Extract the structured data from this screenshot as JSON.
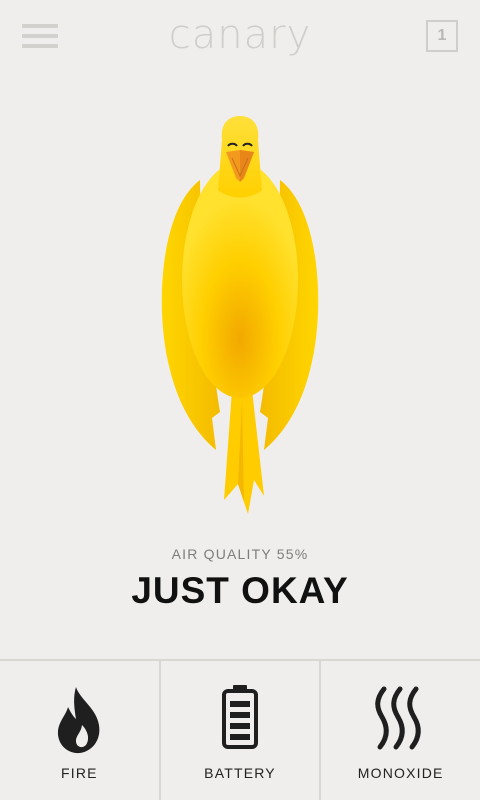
{
  "header": {
    "title": "canary",
    "badge_count": "1"
  },
  "status": {
    "quality_label": "AIR QUALITY",
    "quality_percent": "55%",
    "quality_text": "AIR QUALITY 55%",
    "quality_value": 55,
    "state_label": "JUST OKAY"
  },
  "sensors": [
    {
      "label": "FIRE",
      "icon": "flame-icon"
    },
    {
      "label": "BATTERY",
      "icon": "battery-icon"
    },
    {
      "label": "MONOXIDE",
      "icon": "smoke-waves-icon"
    }
  ],
  "colors": {
    "background": "#efeeec",
    "bird_yellow": "#ffd400",
    "bird_deep_yellow": "#f0b400",
    "beak_orange": "#f39a1e",
    "text_dark": "#111111",
    "text_muted": "#7e7d7b",
    "divider": "#d8d7d4"
  }
}
